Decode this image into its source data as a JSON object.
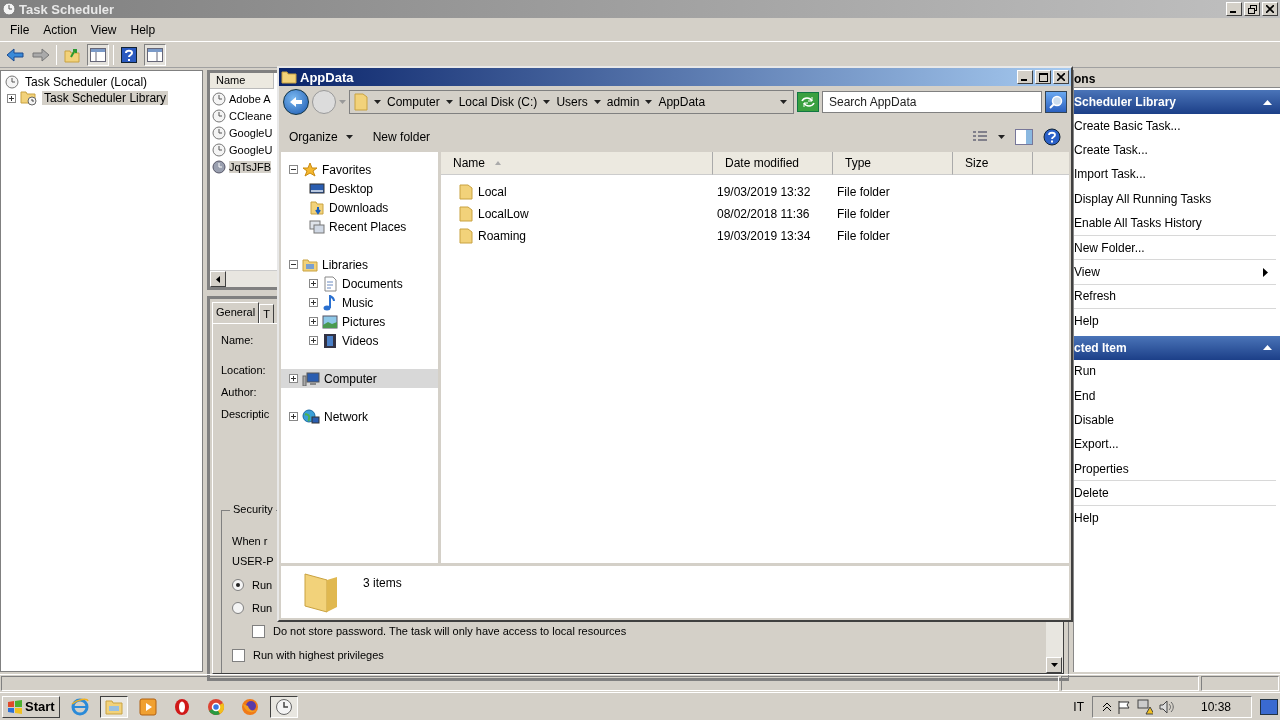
{
  "window": {
    "title": "Task Scheduler"
  },
  "menu": [
    "File",
    "Action",
    "View",
    "Help"
  ],
  "tree": [
    {
      "label": "Task Scheduler (Local)",
      "selected": false,
      "children": [
        {
          "label": "Task Scheduler Library",
          "selected": true,
          "expanded": false
        }
      ]
    }
  ],
  "task_list": {
    "columns": [
      "Name"
    ],
    "rows": [
      {
        "name": "Adobe A",
        "selected": false
      },
      {
        "name": "CCleane",
        "selected": false
      },
      {
        "name": "GoogleU",
        "selected": false
      },
      {
        "name": "GoogleU",
        "selected": false
      },
      {
        "name": "JqTsJFB",
        "selected": true
      }
    ]
  },
  "details": {
    "tabs": [
      {
        "label": "General",
        "selected": true
      },
      {
        "label": "T",
        "selected": false
      }
    ],
    "fields": [
      "Name:",
      "Location:",
      "Author:",
      "Descriptic"
    ],
    "security": {
      "title": "Security",
      "lines": [
        "When r",
        "USER-P"
      ],
      "options": [
        {
          "label": "Run",
          "selected": true
        },
        {
          "label": "Run",
          "selected": false
        }
      ],
      "checks": [
        {
          "label": "Do not store password.  The task will only have access to local resources",
          "checked": false,
          "kind": "indented"
        },
        {
          "label": "Run with highest privileges",
          "checked": false,
          "kind": "plain"
        }
      ]
    }
  },
  "actions": {
    "title": "ons",
    "sections": [
      {
        "title": "Scheduler Library",
        "items": [
          {
            "label": "Create Basic Task...",
            "submenu": false,
            "divider": false
          },
          {
            "label": "Create Task...",
            "submenu": false,
            "divider": false
          },
          {
            "label": "Import Task...",
            "submenu": false,
            "divider": false
          },
          {
            "label": "Display All Running Tasks",
            "submenu": false,
            "divider": false
          },
          {
            "label": "Enable All Tasks History",
            "submenu": false,
            "divider": true
          },
          {
            "label": "New Folder...",
            "submenu": false,
            "divider": true
          },
          {
            "label": "View",
            "submenu": true,
            "divider": true
          },
          {
            "label": "Refresh",
            "submenu": false,
            "divider": true
          },
          {
            "label": "Help",
            "submenu": false,
            "divider": false
          }
        ]
      },
      {
        "title": "cted Item",
        "items": [
          {
            "label": "Run",
            "submenu": false,
            "divider": false
          },
          {
            "label": "End",
            "submenu": false,
            "divider": false
          },
          {
            "label": "Disable",
            "submenu": false,
            "divider": false
          },
          {
            "label": "Export...",
            "submenu": false,
            "divider": false
          },
          {
            "label": "Properties",
            "submenu": false,
            "divider": true
          },
          {
            "label": "Delete",
            "submenu": false,
            "divider": true
          },
          {
            "label": "Help",
            "submenu": false,
            "divider": false
          }
        ]
      }
    ]
  },
  "explorer": {
    "title": "AppData",
    "breadcrumb": [
      "Computer",
      "Local Disk (C:)",
      "Users",
      "admin",
      "AppData"
    ],
    "search": {
      "placeholder": "Search AppData"
    },
    "commands": [
      "Organize",
      "New folder"
    ],
    "nav": [
      {
        "label": "Favorites",
        "kind": "favorites",
        "expanded": true,
        "selected": false,
        "children": [
          {
            "label": "Desktop",
            "kind": "desktop",
            "selected": false
          },
          {
            "label": "Downloads",
            "kind": "downloads",
            "selected": false
          },
          {
            "label": "Recent Places",
            "kind": "recent",
            "selected": false
          }
        ]
      },
      {
        "label": "Libraries",
        "kind": "libraries",
        "expanded": true,
        "selected": false,
        "children": [
          {
            "label": "Documents",
            "kind": "documents",
            "expanded": false,
            "selected": false
          },
          {
            "label": "Music",
            "kind": "music",
            "expanded": false,
            "selected": false
          },
          {
            "label": "Pictures",
            "kind": "pictures",
            "expanded": false,
            "selected": false
          },
          {
            "label": "Videos",
            "kind": "videos",
            "expanded": false,
            "selected": false
          }
        ]
      },
      {
        "label": "Computer",
        "kind": "computer",
        "expanded": false,
        "selected": true
      },
      {
        "label": "Network",
        "kind": "network",
        "expanded": false,
        "selected": false
      }
    ],
    "columns": [
      "Name",
      "Date modified",
      "Type",
      "Size"
    ],
    "rows": [
      {
        "name": "Local",
        "date": "19/03/2019 13:32",
        "type": "File folder",
        "selected": false
      },
      {
        "name": "LocalLow",
        "date": "08/02/2018 11:36",
        "type": "File folder",
        "selected": false
      },
      {
        "name": "Roaming",
        "date": "19/03/2019 13:34",
        "type": "File folder",
        "selected": false
      }
    ],
    "status": "3 items"
  },
  "taskbar": {
    "start": "Start",
    "apps": [
      {
        "kind": "ie",
        "selected": false
      },
      {
        "kind": "explorer",
        "selected": true
      },
      {
        "kind": "media",
        "selected": false
      },
      {
        "kind": "opera",
        "selected": false
      },
      {
        "kind": "chrome",
        "selected": false
      },
      {
        "kind": "firefox",
        "selected": false
      },
      {
        "kind": "clock",
        "selected": true
      }
    ],
    "language": "IT",
    "time": "10:38"
  }
}
